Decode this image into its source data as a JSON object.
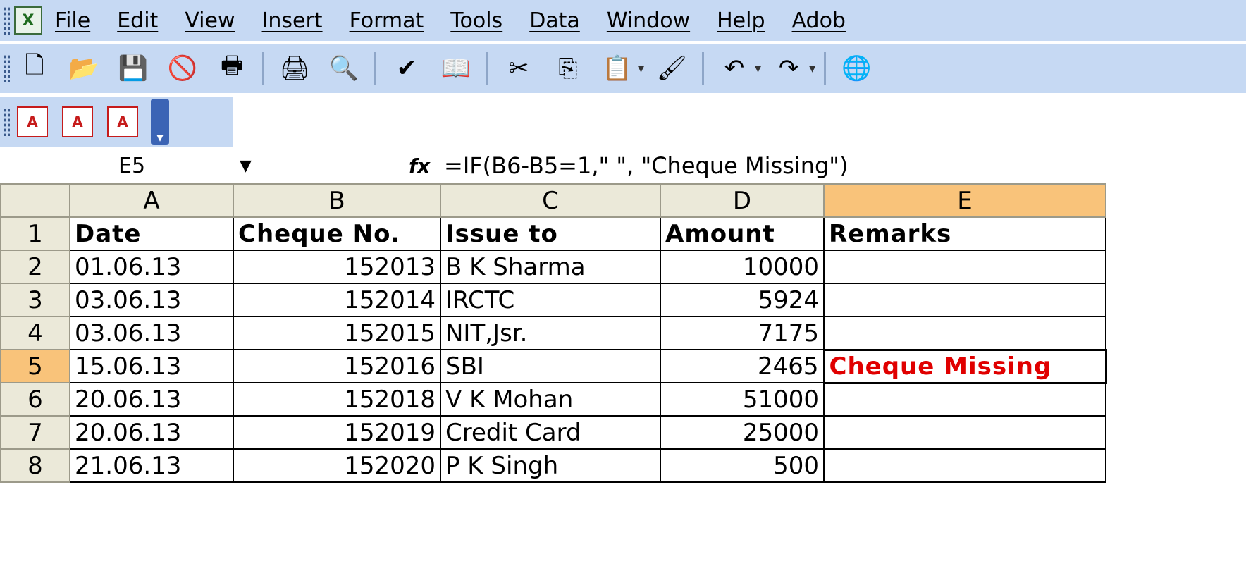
{
  "menu": [
    "File",
    "Edit",
    "View",
    "Insert",
    "Format",
    "Tools",
    "Data",
    "Window",
    "Help",
    "Adob"
  ],
  "toolbar_icons": [
    "new-document-icon",
    "open-folder-icon",
    "save-icon",
    "permission-icon",
    "print-preview-icon",
    "print-icon",
    "search-icon",
    "spelling-icon",
    "research-icon",
    "cut-icon",
    "copy-icon",
    "paste-icon",
    "format-painter-icon",
    "undo-icon",
    "redo-icon",
    "hyperlink-icon"
  ],
  "formula_bar": {
    "cell_ref": "E5",
    "formula": "=IF(B6-B5=1,\" \", \"Cheque Missing\")"
  },
  "columns": [
    "A",
    "B",
    "C",
    "D",
    "E"
  ],
  "rows": [
    {
      "n": "1",
      "a": "Date",
      "b": "Cheque No.",
      "c": "Issue to",
      "d": "Amount",
      "e": "Remarks"
    },
    {
      "n": "2",
      "a": "01.06.13",
      "b": "152013",
      "c": "B K Sharma",
      "d": "10000",
      "e": ""
    },
    {
      "n": "3",
      "a": "03.06.13",
      "b": "152014",
      "c": "IRCTC",
      "d": "5924",
      "e": ""
    },
    {
      "n": "4",
      "a": "03.06.13",
      "b": "152015",
      "c": "NIT,Jsr.",
      "d": "7175",
      "e": ""
    },
    {
      "n": "5",
      "a": "15.06.13",
      "b": "152016",
      "c": "SBI",
      "d": "2465",
      "e": "Cheque Missing"
    },
    {
      "n": "6",
      "a": "20.06.13",
      "b": "152018",
      "c": "V K Mohan",
      "d": "51000",
      "e": ""
    },
    {
      "n": "7",
      "a": "20.06.13",
      "b": "152019",
      "c": "Credit Card",
      "d": "25000",
      "e": ""
    },
    {
      "n": "8",
      "a": "21.06.13",
      "b": "152020",
      "c": "P K Singh",
      "d": "500",
      "e": ""
    }
  ]
}
